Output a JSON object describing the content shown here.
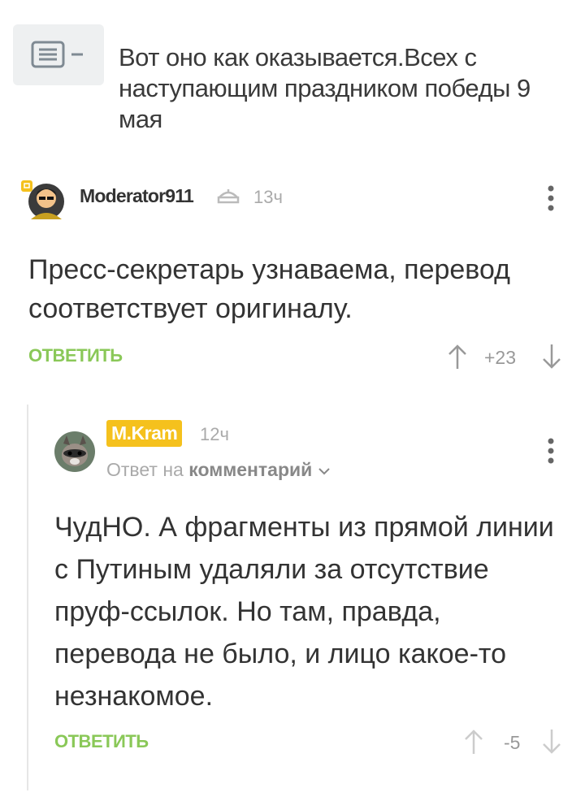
{
  "post": {
    "title": "Вот оно как оказывается.Всех с наступающим праздником победы 9 мая",
    "icon": "comment-lines-icon"
  },
  "comments": [
    {
      "author": "Moderator911",
      "author_badge": "moderator-icon",
      "time": "13ч",
      "text": "Пресс-секретарь узнаваема, перевод соответствует оригиналу.",
      "reply_label": "ОТВЕТИТЬ",
      "rating": "+23"
    },
    {
      "author": "M.Kram",
      "time": "12ч",
      "reply_to_prefix": "Ответ на",
      "reply_to_link": "комментарий",
      "text": "ЧудНО. А фрагменты из прямой линии с Путиным удаляли за отсутствие пруф-ссылок. Но там, правда, перевода не было, и лицо какое-то незнакомое.",
      "reply_label": "ОТВЕТИТЬ",
      "rating": "-5"
    }
  ],
  "colors": {
    "accent_green": "#8ac858",
    "author_highlight": "#f5c11d",
    "muted": "#aaaaaa"
  }
}
